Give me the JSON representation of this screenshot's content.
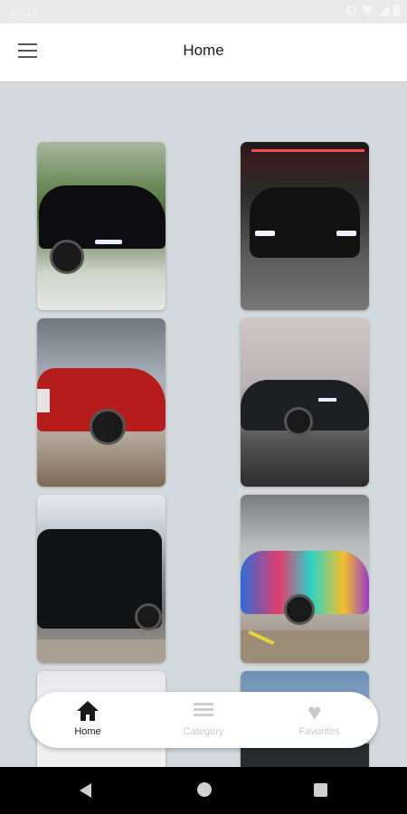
{
  "status_bar": {
    "time": "10:10"
  },
  "app_bar": {
    "title": "Home"
  },
  "grid": {
    "items": [
      {
        "alt": "black Rolls-Royce by trees"
      },
      {
        "alt": "black Rolls-Royce at night"
      },
      {
        "alt": "red Rolls-Royce Cullinan"
      },
      {
        "alt": "dark Rolls-Royce at dusk"
      },
      {
        "alt": "black Rolls-Royce Cullinan in city"
      },
      {
        "alt": "colorful painted Rolls-Royce"
      },
      {
        "alt": "white car partial"
      },
      {
        "alt": "car partial"
      }
    ]
  },
  "bottom_nav": {
    "items": [
      {
        "label": "Home",
        "icon": "home-icon",
        "active": true
      },
      {
        "label": "Category",
        "icon": "list-icon",
        "active": false
      },
      {
        "label": "Favorites",
        "icon": "heart-icon",
        "active": false
      }
    ]
  },
  "colors": {
    "background": "#d3dadd",
    "app_bar": "#ffffff",
    "active_nav": "#1a1a1a",
    "inactive_nav": "#c9c9c9",
    "system_nav": "#000000"
  }
}
